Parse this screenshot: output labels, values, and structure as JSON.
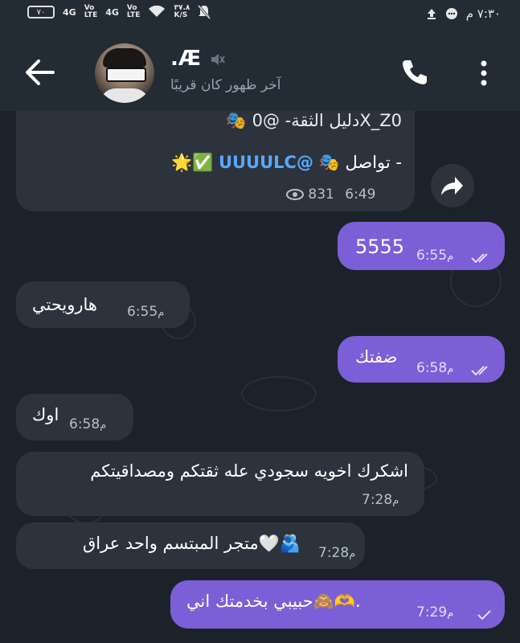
{
  "status_bar": {
    "battery": "٧٠",
    "network1": "4G",
    "volte1_top": "Vo",
    "volte1_bottom": "LTE",
    "network2": "4G",
    "volte2_top": "Vo",
    "volte2_bottom": "LTE",
    "speed_value": "٣٧.٨",
    "speed_unit": "K/S",
    "time": "٧:٣٠ م"
  },
  "header": {
    "contact_name": ".Æ",
    "last_seen": "آخر ظهور كان قريبًا"
  },
  "channel_post": {
    "line1": "🎭 دليل الثقة- @0X_Z0",
    "line2_label": "🎭 تواصل - ",
    "line2_handle": "UUUULC@",
    "line2_emoji": "🌟✅",
    "views": "831",
    "time": "6:49"
  },
  "messages": [
    {
      "dir": "out",
      "text": "5555",
      "time": "6:55",
      "suffix": "م"
    },
    {
      "dir": "in",
      "text": "هارويحتي",
      "time": "6:55",
      "suffix": "م"
    },
    {
      "dir": "out",
      "text": "ضفتك",
      "time": "6:58",
      "suffix": "م"
    },
    {
      "dir": "in",
      "text": "اوك",
      "time": "6:58",
      "suffix": "م"
    },
    {
      "dir": "in",
      "text": "اشكرك اخويه سجودي عله ثقتكم ومصداقيتكم",
      "time": "7:28",
      "suffix": "م"
    },
    {
      "dir": "in",
      "text": "متجر المبتسم واحد عراق🤍🫂",
      "time": "7:28",
      "suffix": "م"
    },
    {
      "dir": "out",
      "text": "حبيبي بخدمتك اني🙈🫶.",
      "time": "7:29",
      "suffix": "م"
    }
  ],
  "icons": [
    "back-arrow-icon",
    "mute-icon",
    "phone-icon",
    "more-vert-icon",
    "forward-icon",
    "eye-icon",
    "double-check-icon",
    "single-check-icon",
    "wifi-icon",
    "upload-icon",
    "chat-bubble-icon",
    "bell-off-icon"
  ]
}
